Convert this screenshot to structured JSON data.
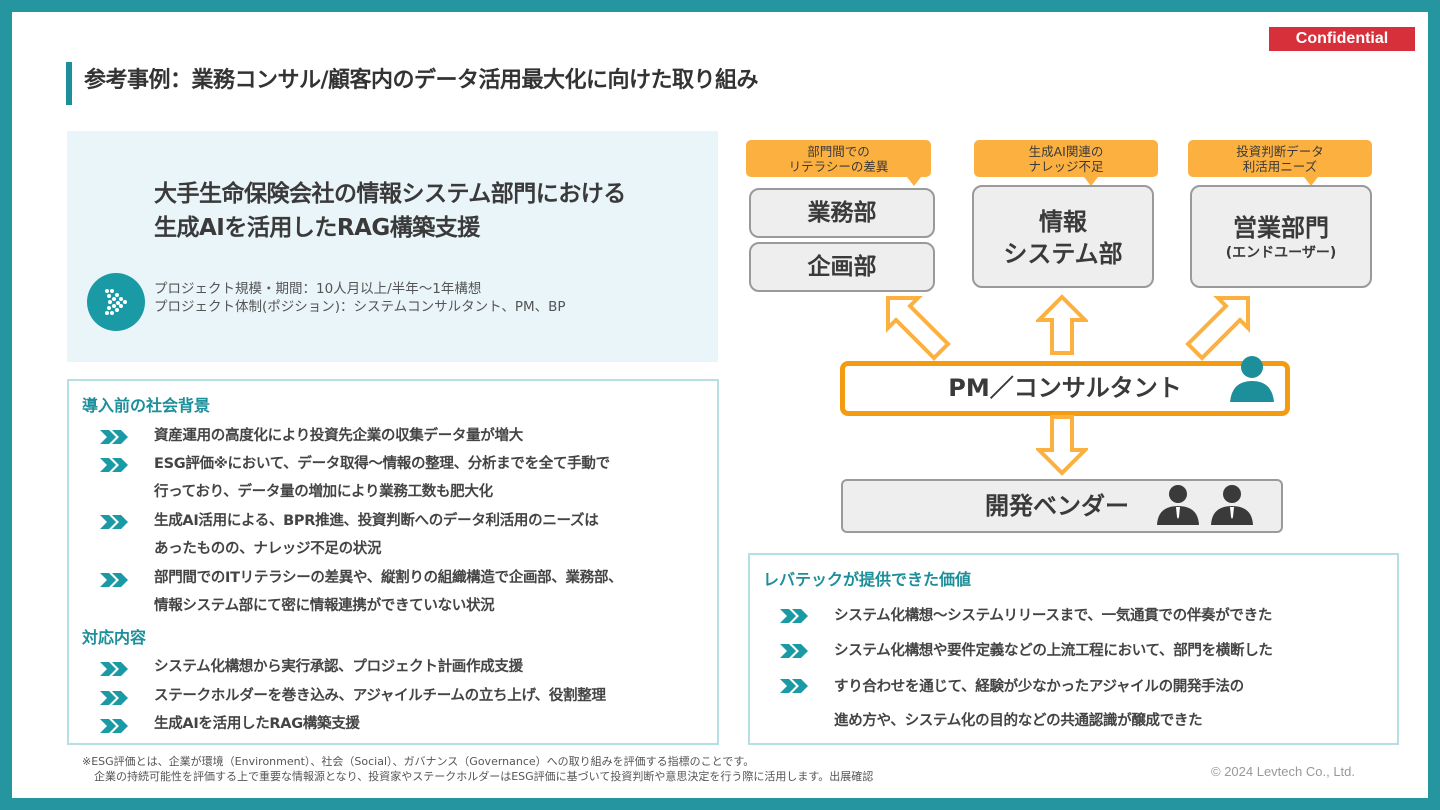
{
  "badge": "Confidential",
  "title": "参考事例：業務コンサル/顧客内のデータ活用最大化に向けた取り組み",
  "project": {
    "title_line1": "大手生命保険会社の情報システム部門における",
    "title_line2": "生成AIを活用したRAG構築支援",
    "scale": "プロジェクト規模・期間：10人月以上/半年〜1年構想",
    "structure": "プロジェクト体制(ポジション)：システムコンサルタント、PM、BP"
  },
  "background": {
    "heading": "導入前の社会背景",
    "items": [
      {
        "line1": "資産運用の高度化により投資先企業の収集データ量が増大"
      },
      {
        "line1": "ESG評価※において、データ取得〜情報の整理、分析までを全て手動で",
        "line2": "行っており、データ量の増加により業務工数も肥大化"
      },
      {
        "line1": "生成AI活用による、BPR推進、投資判断へのデータ利活用のニーズは",
        "line2": "あったものの、ナレッジ不足の状況"
      },
      {
        "line1": "部門間でのITリテラシーの差異や、縦割りの組織構造で企画部、業務部、",
        "line2": "情報システム部にて密に情報連携ができていない状況"
      }
    ]
  },
  "response": {
    "heading": "対応内容",
    "items": [
      "システム化構想から実行承認、プロジェクト計画作成支援",
      "ステークホルダーを巻き込み、アジャイルチームの立ち上げ、役割整理",
      "生成AIを活用したRAG構築支援"
    ]
  },
  "diagram": {
    "bubbles": [
      {
        "line1": "部門間での",
        "line2": "リテラシーの差異"
      },
      {
        "line1": "生成AI関連の",
        "line2": "ナレッジ不足"
      },
      {
        "line1": "投資判断データ",
        "line2": "利活用ニーズ"
      }
    ],
    "dept_business": "業務部",
    "dept_planning": "企画部",
    "dept_it_line1": "情報",
    "dept_it_line2": "システム部",
    "dept_sales": "営業部門",
    "dept_sales_sub": "(エンドユーザー)",
    "pm": "PM／コンサルタント",
    "vendor": "開発ベンダー",
    "colors": {
      "accent": "#f39c12",
      "bubble": "#fbb040",
      "teal": "#1d8f9a"
    }
  },
  "value": {
    "heading": "レバテックが提供できた価値",
    "items": [
      {
        "line1": "システム化構想〜システムリリースまで、一気通貫での伴奏ができた"
      },
      {
        "line1": "システム化構想や要件定義などの上流工程において、部門を横断した"
      },
      {
        "line1": "すり合わせを通じて、経験が少なかったアジャイルの開発手法の",
        "line2": "進め方や、システム化の目的などの共通認識が醸成できた"
      }
    ]
  },
  "footnote": {
    "line1": "※ESG評価とは、企業が環境（Environment）、社会（Social）、ガバナンス（Governance）への取り組みを評価する指標のことです。",
    "line2": "企業の持続可能性を評価する上で重要な情報源となり、投資家やステークホルダーはESG評価に基づいて投資判断や意思決定を行う際に活用します。出展確認"
  },
  "copyright": "© 2024 Levtech Co., Ltd."
}
